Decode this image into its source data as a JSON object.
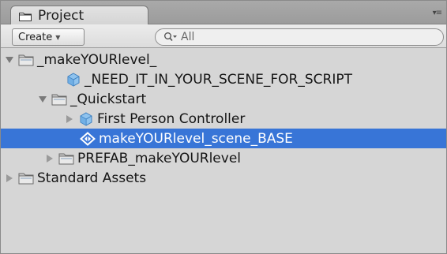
{
  "tab": {
    "title": "Project",
    "icon": "folder-icon"
  },
  "toolbar": {
    "create_label": "Create",
    "search_placeholder": "All"
  },
  "tree": {
    "items": [
      {
        "label": "_makeYOURlevel_",
        "icon": "folder-icon",
        "expanded": true
      },
      {
        "label": "_NEED_IT_IN_YOUR_SCENE_FOR_SCRIPT",
        "icon": "prefab-cube-icon"
      },
      {
        "label": "_Quickstart",
        "icon": "folder-icon",
        "expanded": true
      },
      {
        "label": "First Person Controller",
        "icon": "prefab-cube-icon",
        "expanded": false
      },
      {
        "label": "makeYOURlevel_scene_BASE",
        "icon": "unity-scene-icon",
        "selected": true
      },
      {
        "label": "PREFAB_makeYOURlevel",
        "icon": "folder-icon",
        "expanded": false
      },
      {
        "label": "Standard Assets",
        "icon": "folder-icon",
        "expanded": false
      }
    ]
  },
  "colors": {
    "selection": "#3875d7",
    "panel": "#d6d6d6"
  }
}
